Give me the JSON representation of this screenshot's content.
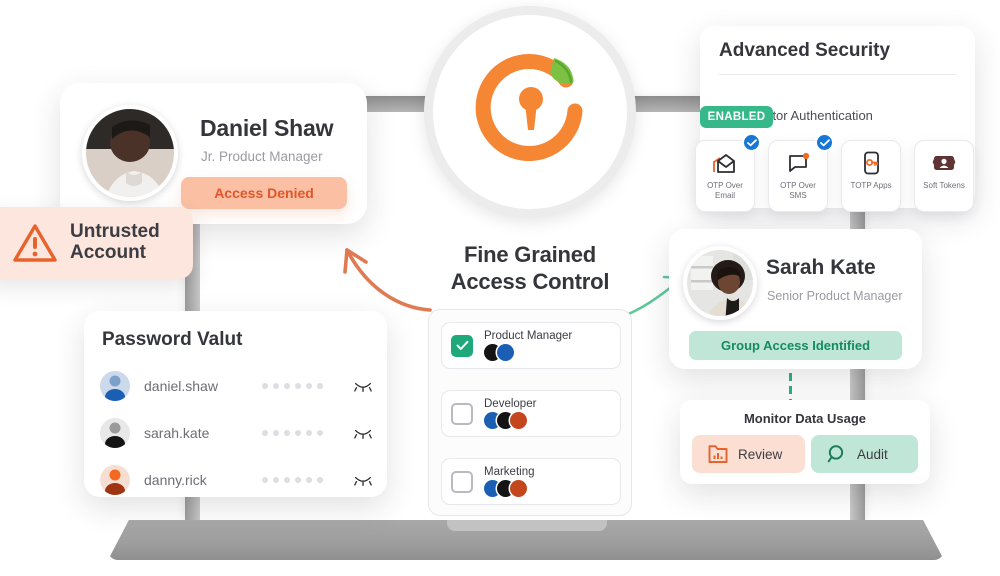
{
  "logo": {
    "name": "app-logo",
    "colors": {
      "ring": "#f58634",
      "leaf": "#7cc142"
    }
  },
  "daniel_card": {
    "name": "Daniel Shaw",
    "role": "Jr. Product Manager",
    "status_label": "Access Denied",
    "status_color": "#e2562a"
  },
  "untrusted_badge": {
    "line1": "Untrusted",
    "line2": "Account",
    "icon": "warning-triangle-icon",
    "color": "#e8622c"
  },
  "password_vault": {
    "title": "Password Valut",
    "rows": [
      {
        "username": "daniel.shaw",
        "password_masked": "••••••",
        "toggle": "eye-closed-icon",
        "avatar_color": "#1a5fb4"
      },
      {
        "username": "sarah.kate",
        "password_masked": "••••••",
        "toggle": "eye-closed-icon",
        "avatar_color": "#141414"
      },
      {
        "username": "danny.rick",
        "password_masked": "••••••",
        "toggle": "eye-closed-icon",
        "avatar_color": "#9e3412"
      }
    ]
  },
  "fine_grained": {
    "title_line1": "Fine Grained",
    "title_line2": "Access Control",
    "roles": [
      {
        "label": "Product Manager",
        "checked": true,
        "avatars": [
          "#141414",
          "#1a5fb4"
        ]
      },
      {
        "label": "Developer",
        "checked": false,
        "avatars": [
          "#1a5fb4",
          "#141414",
          "#c3461c"
        ]
      },
      {
        "label": "Marketing",
        "checked": false,
        "avatars": [
          "#1a5fb4",
          "#141414",
          "#c3461c"
        ]
      }
    ],
    "checked_color": "#1fa97a"
  },
  "advanced_security": {
    "title": "Advanced Security",
    "mfa_label": "Multi-Factor Authentication",
    "mfa_status": "ENABLED",
    "mfa_status_color": "#37b88a",
    "methods": [
      {
        "label_line1": "OTP Over",
        "label_line2": "Email",
        "icon": "open-envelope-icon",
        "selected": true
      },
      {
        "label_line1": "OTP Over",
        "label_line2": "SMS",
        "icon": "chat-bubble-icon",
        "selected": true
      },
      {
        "label_line1": "TOTP Apps",
        "label_line2": "",
        "icon": "phone-key-icon",
        "selected": false
      },
      {
        "label_line1": "Soft Tokens",
        "label_line2": "",
        "icon": "id-badge-icon",
        "selected": false
      }
    ]
  },
  "sarah_card": {
    "name": "Sarah Kate",
    "role": "Senior Product Manager",
    "status_label": "Group Access Identified",
    "status_color": "#168a63"
  },
  "monitor": {
    "title": "Monitor Data Usage",
    "buttons": [
      {
        "label": "Review",
        "icon": "bar-chart-folder-icon",
        "bg": "#fbdfd3",
        "icon_color": "#e8622c"
      },
      {
        "label": "Audit",
        "icon": "magnifier-icon",
        "bg": "#bfe6d6",
        "icon_color": "#1a7a59"
      }
    ]
  },
  "connectors": {
    "orange_arrow": "arrow-to-daniel-card",
    "green_arrow": "arrow-to-sarah-card",
    "green_dashed": "link-sarah-to-monitor"
  }
}
